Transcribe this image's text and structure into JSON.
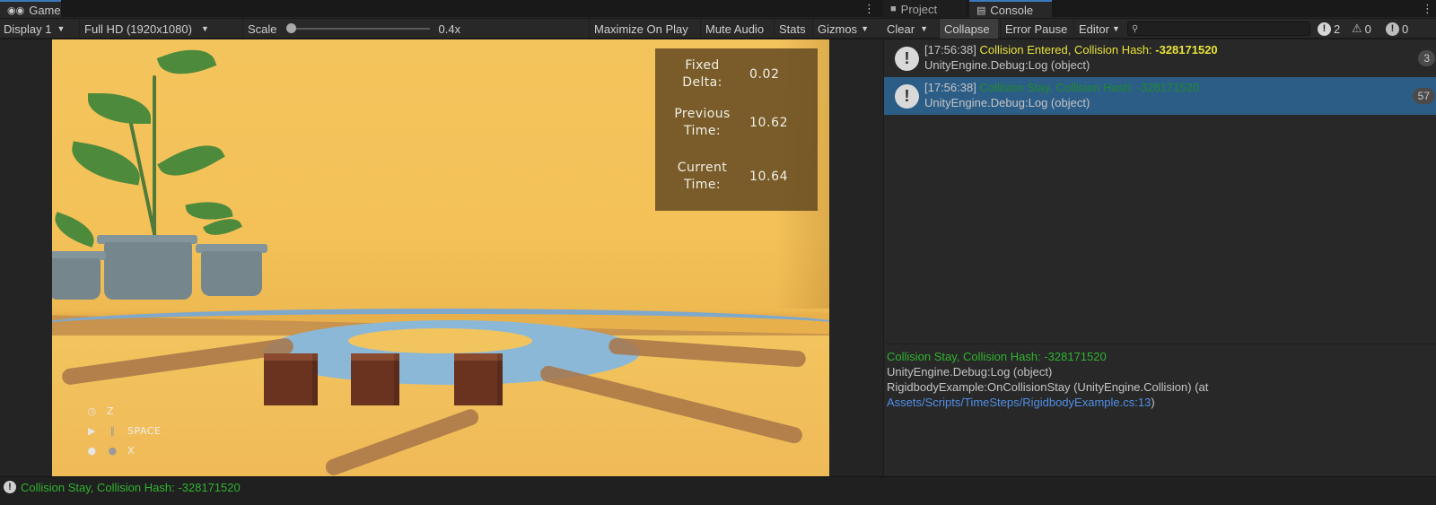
{
  "game_panel": {
    "tab_label": "Game",
    "toolbar": {
      "display": "Display 1",
      "resolution": "Full HD (1920x1080)",
      "scale_label": "Scale",
      "scale_value": "0.4x",
      "maximize_on_play": "Maximize On Play",
      "mute_audio": "Mute Audio",
      "stats": "Stats",
      "gizmos": "Gizmos"
    },
    "stats_overlay": {
      "rows": [
        {
          "label_line1": "Fixed",
          "label_line2": "Delta:",
          "value": "0.02"
        },
        {
          "label_line1": "Previous",
          "label_line2": "Time:",
          "value": "10.62"
        },
        {
          "label_line1": "Current",
          "label_line2": "Time:",
          "value": "10.64"
        }
      ]
    },
    "controls": [
      {
        "icon": "clock-icon",
        "key": "Z"
      },
      {
        "icon": "play-pause-icon",
        "key": "SPACE"
      },
      {
        "icon": "physics-icon",
        "key": "X"
      }
    ]
  },
  "console_panel": {
    "tabs": [
      {
        "label": "Project",
        "icon": "folder-icon"
      },
      {
        "label": "Console",
        "icon": "console-icon"
      }
    ],
    "toolbar": {
      "clear": "Clear",
      "collapse": "Collapse",
      "error_pause": "Error Pause",
      "editor": "Editor",
      "search_placeholder": "",
      "info_count": "2",
      "warning_count": "0",
      "error_count": "0"
    },
    "entries": [
      {
        "time": "[17:56:38]",
        "message": "Collision Entered, Collision Hash: ",
        "hash": "-328171520",
        "source": "UnityEngine.Debug:Log (object)",
        "count": "3"
      },
      {
        "time": "[17:56:38]",
        "message": "Collision Stay, Collision Hash: ",
        "hash": "-328171520",
        "source": "UnityEngine.Debug:Log (object)",
        "count": "57"
      }
    ],
    "detail": {
      "message": "Collision Stay, Collision Hash: -328171520",
      "line2": "UnityEngine.Debug:Log (object)",
      "line3": "RigidbodyExample:OnCollisionStay (UnityEngine.Collision) (at",
      "link": "Assets/Scripts/TimeSteps/RigidbodyExample.cs:13",
      "closing": ")"
    }
  },
  "status_bar": {
    "message": "Collision Stay, Collision Hash: -328171520"
  },
  "colors": {
    "accent_blue": "#2c5d87",
    "log_yellow": "#e8e23a",
    "log_green": "#2fb32f",
    "link_blue": "#4f8fe6"
  }
}
